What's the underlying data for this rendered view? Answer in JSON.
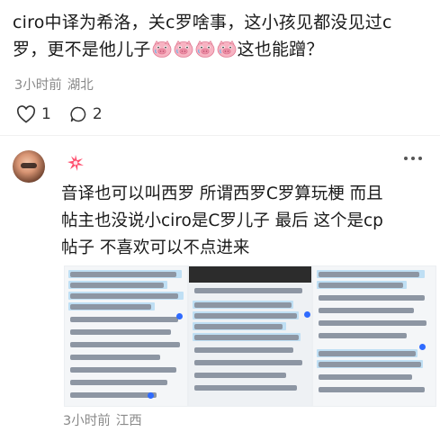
{
  "post": {
    "line1": "ciro中译为希洛，关c罗啥事，这小孩见都没见过c",
    "line2_prefix": "罗，更不是他儿子",
    "line2_suffix": "这也能蹭？",
    "emoji_count": 4,
    "time": "3小时前",
    "location": "湖北",
    "like_count": "1",
    "comment_count": "2"
  },
  "comment": {
    "username_icon": "sparkle-badge-icon",
    "text": "音译也可以叫西罗 所谓西罗C罗算玩梗 而且帖主也没说小ciro是C罗儿子 最后 这个是cp帖子 不喜欢可以不点进来",
    "line1": "音译也可以叫西罗 所谓西罗C罗算玩梗 而且",
    "line2": "帖主也没说小ciro是C罗儿子 最后 这个是cp",
    "line3": "帖子 不喜欢可以不点进来",
    "images": [
      {
        "name": "screenshot-1",
        "icon": "document-screenshot-icon"
      },
      {
        "name": "screenshot-2",
        "icon": "document-screenshot-icon"
      },
      {
        "name": "screenshot-3",
        "icon": "document-screenshot-icon"
      }
    ],
    "time": "3小时前",
    "location": "江西"
  },
  "colors": {
    "text": "#1a1a1a",
    "meta": "#8a8a8a",
    "highlight": "#bfdff4",
    "accent_blue": "#2f6bff",
    "badge_pink": "#ff4d6d"
  }
}
